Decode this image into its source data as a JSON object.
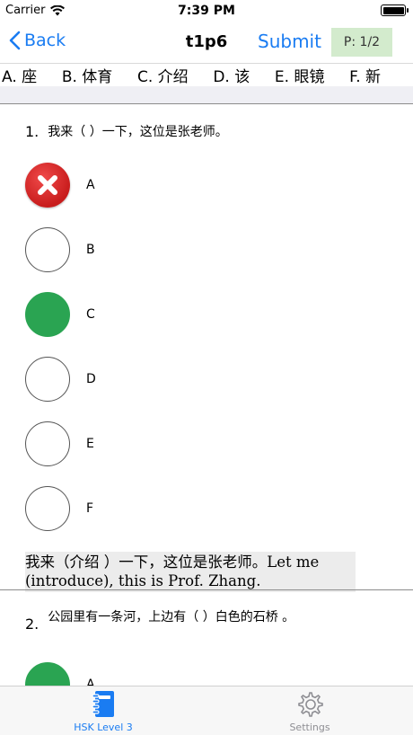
{
  "status_bar": {
    "carrier": "Carrier",
    "time": "7:39 PM"
  },
  "nav": {
    "back_label": "Back",
    "title": "t1p6",
    "submit_label": "Submit",
    "page_indicator": "P: 1/2"
  },
  "word_bank": [
    "A. 座",
    "B. 体育",
    "C. 介绍",
    "D. 该",
    "E. 眼镜",
    "F. 新"
  ],
  "questions": [
    {
      "number": "1.",
      "text": "我来（ ）一下，这位是张老师。",
      "options": [
        {
          "label": "A",
          "state": "wrong"
        },
        {
          "label": "B",
          "state": "empty"
        },
        {
          "label": "C",
          "state": "correct"
        },
        {
          "label": "D",
          "state": "empty"
        },
        {
          "label": "E",
          "state": "empty"
        },
        {
          "label": "F",
          "state": "empty"
        }
      ],
      "explanation": "我来（介绍 ）一下，这位是张老师。Let me (introduce), this is Prof. Zhang."
    },
    {
      "number": "2.",
      "text": "公园里有一条河，上边有（ ）白色的石桥 。",
      "options": [
        {
          "label": "A",
          "state": "correct"
        }
      ]
    }
  ],
  "tabs": [
    {
      "label": "HSK Level 3",
      "icon": "notebook-icon",
      "active": true
    },
    {
      "label": "Settings",
      "icon": "gear-icon",
      "active": false
    }
  ],
  "colors": {
    "accent": "#1a7cf2",
    "correct": "#2aa452",
    "wrong": "#d92626",
    "page_badge": "#d3ebcd"
  }
}
